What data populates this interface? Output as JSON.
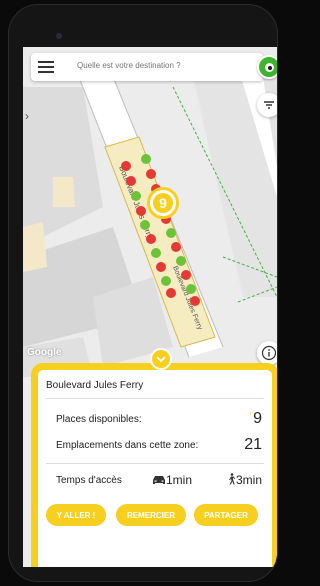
{
  "search": {
    "placeholder": "Quelle est votre destination ?"
  },
  "map": {
    "attribution": "Google",
    "street_label_1": "Boulevard Jules Ferry",
    "street_label_2": "Boulevard Jules Ferry",
    "cluster_count": "9"
  },
  "panel": {
    "street_name": "Boulevard Jules Ferry",
    "available_label": "Places disponibles:",
    "available_value": "9",
    "zone_label": "Emplacements dans cette zone:",
    "zone_value": "21",
    "access_label": "Temps d'accès",
    "car_time": "1min",
    "walk_time": "3min",
    "buttons": {
      "go": "Y ALLER !",
      "thanks": "REMERCIER",
      "share": "PARTAGER"
    }
  },
  "colors": {
    "accent": "#f7cf1e",
    "available": "#6cc33a",
    "occupied": "#e53935",
    "brand": "#3fb52f"
  }
}
